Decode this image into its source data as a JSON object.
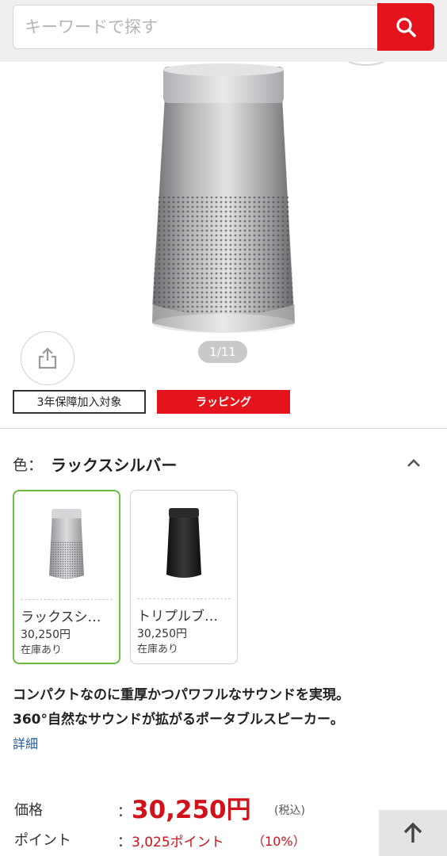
{
  "search": {
    "placeholder": "キーワードで探す",
    "button_icon": "search-icon"
  },
  "product": {
    "image_pager": "1/11",
    "badges": {
      "warranty": "3年保障加入対象",
      "wrapping": "ラッピング"
    },
    "color": {
      "label": "色：",
      "value": "ラックスシルバー"
    },
    "variants": [
      {
        "name": "ラックスシ…",
        "price": "30,250円",
        "stock": "在庫あり",
        "color": "#b9bbbd",
        "selected": true
      },
      {
        "name": "トリプルブ…",
        "price": "30,250円",
        "stock": "在庫あり",
        "color": "#1e1e1e",
        "selected": false
      }
    ],
    "description": [
      "コンパクトなのに重厚かつパワフルなサウンドを実現。",
      "360°自然なサウンドが拡がるポータブルスピーカー。"
    ],
    "detail_link": "詳細",
    "price": {
      "label": "価格",
      "colon": "：",
      "value": "30,250円",
      "tax_note": "(税込)"
    },
    "points": {
      "label": "ポイント",
      "colon": "：",
      "value": "3,025ポイント",
      "rate": "（10%）"
    }
  },
  "colors": {
    "accent": "#e5131c",
    "price": "#d0121b",
    "link": "#1f5aa8",
    "selected_border": "#6cbf42"
  }
}
